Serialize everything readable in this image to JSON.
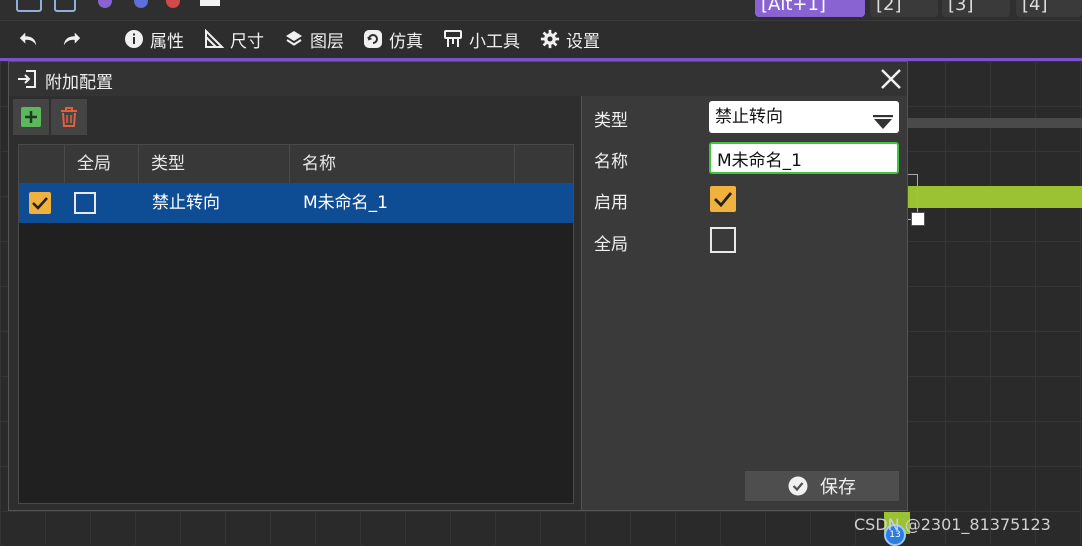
{
  "top_tabs": [
    {
      "label": "[Alt+1]",
      "active": true
    },
    {
      "label": "[2]",
      "active": false
    },
    {
      "label": "[3]",
      "active": false
    },
    {
      "label": "[4]",
      "active": false
    }
  ],
  "toolbar": {
    "items": [
      {
        "label": "属性",
        "icon": "info-icon"
      },
      {
        "label": "尺寸",
        "icon": "ruler-triangle-icon"
      },
      {
        "label": "图层",
        "icon": "layers-icon"
      },
      {
        "label": "仿真",
        "icon": "simulation-icon"
      },
      {
        "label": "小工具",
        "icon": "tools-icon"
      },
      {
        "label": "设置",
        "icon": "gear-icon"
      }
    ],
    "accent_color": "#7a52c9"
  },
  "dialog": {
    "title": "附加配置",
    "table": {
      "headers": [
        "",
        "全局",
        "类型",
        "名称",
        ""
      ],
      "rows": [
        {
          "enabled": true,
          "global": false,
          "type": "禁止转向",
          "name": "M未命名_1",
          "selected": true
        }
      ]
    },
    "form": {
      "type_label": "类型",
      "type_value": "禁止转向",
      "name_label": "名称",
      "name_value": "M未命名_1",
      "enabled_label": "启用",
      "enabled": true,
      "global_label": "全局",
      "global": false
    },
    "save_label": "保存"
  },
  "canvas": {
    "badge_text": "13"
  },
  "watermark": "CSDN @2301_81375123",
  "colors": {
    "selection": "#0e4c94",
    "checkbox_checked": "#f0b23c",
    "focus_border": "#3fc43f",
    "add_green": "#5cb85c",
    "delete_red": "#e06040",
    "canvas_green": "#9bc233"
  }
}
